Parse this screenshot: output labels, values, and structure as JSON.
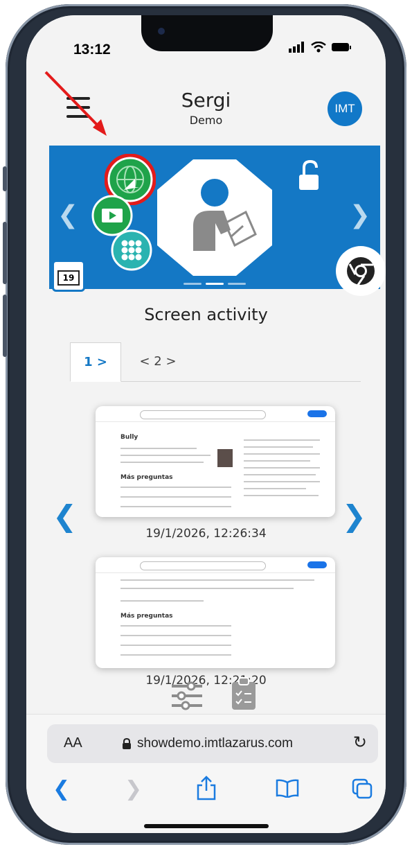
{
  "status": {
    "time": "13:12"
  },
  "header": {
    "title": "Sergi",
    "subtitle": "Demo",
    "avatar": "IMT"
  },
  "banner": {
    "calendar_day": "19",
    "icons": [
      "globe-cursor-icon",
      "video-icon",
      "apps-grid-icon",
      "lock-open-icon",
      "user-writing-icon",
      "chrome-icon",
      "calendar-icon"
    ]
  },
  "section": {
    "title": "Screen activity"
  },
  "tabs": [
    {
      "label": "1 >"
    },
    {
      "label": "< 2 >"
    }
  ],
  "screenshots": [
    {
      "caption": "19/1/2026, 12:26:34",
      "heading": "Bully",
      "section": "Más preguntas"
    },
    {
      "caption": "19/1/2026, 12:21:20",
      "heading": "",
      "section": "Más preguntas"
    }
  ],
  "safari": {
    "aa": "AA",
    "url": "showdemo.imtlazarus.com"
  },
  "colors": {
    "accent": "#1478c5",
    "annotation": "#e31b1b",
    "green": "#1fa34a",
    "teal": "#2ab3b0"
  }
}
